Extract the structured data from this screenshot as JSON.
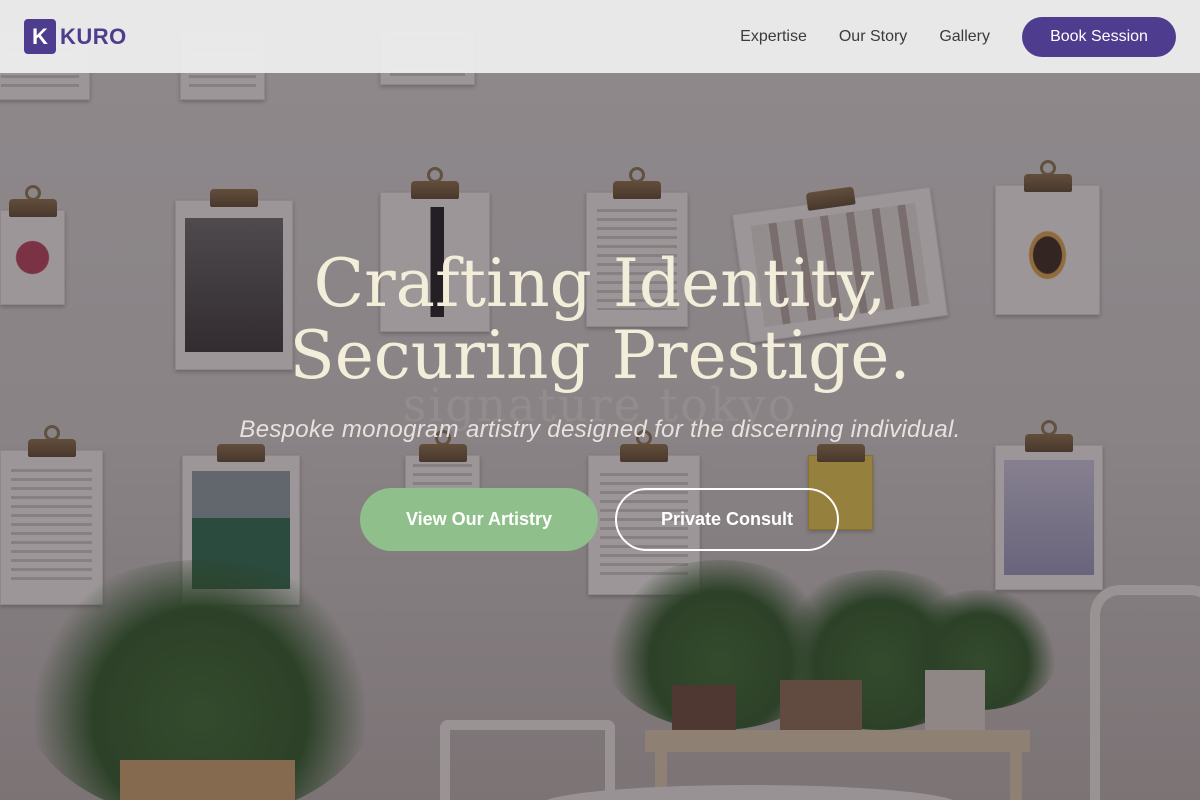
{
  "brand": {
    "mark": "K",
    "name": "KURO",
    "color": "#4e3d8f"
  },
  "nav": {
    "links": [
      "Expertise",
      "Our Story",
      "Gallery"
    ],
    "cta": "Book Session"
  },
  "hero": {
    "title_line1": "Crafting Identity,",
    "title_line2": "Securing Prestige.",
    "watermark": "signature tokyo",
    "subtitle": "Bespoke monogram artistry designed for the discerning individual.",
    "primary_button": "View Our Artistry",
    "secondary_button": "Private Consult"
  },
  "colors": {
    "accent_purple": "#4e3d8f",
    "accent_green": "#8fbf8b",
    "title_cream": "#f3eed9"
  }
}
